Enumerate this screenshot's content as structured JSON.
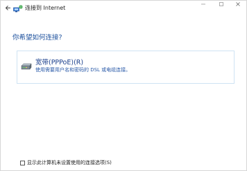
{
  "window": {
    "title": "连接到 Internet"
  },
  "main": {
    "heading": "你希望如何连接?"
  },
  "option": {
    "title": "宽带(PPPoE)(R)",
    "description": "使用需要用户名和密码的 DSL 或电缆连接。"
  },
  "footer": {
    "checkbox_label": "显示此计算机未设置使用的连接选项(S)",
    "checkbox_checked": false
  },
  "icons": {
    "back": "back-arrow-icon",
    "app": "network-icon",
    "option": "broadband-modem-icon"
  }
}
